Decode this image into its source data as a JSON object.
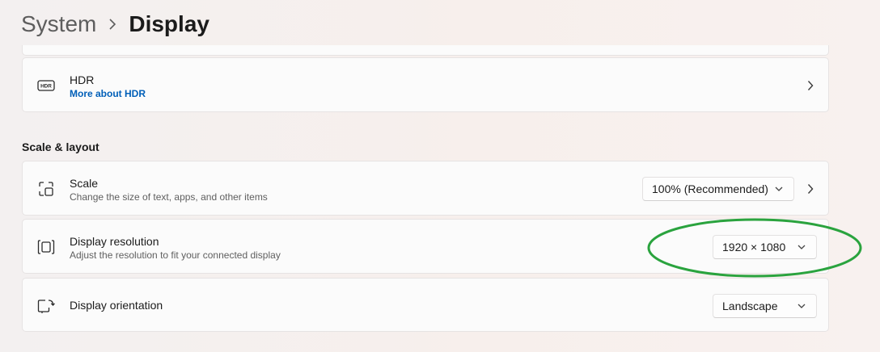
{
  "breadcrumb": {
    "parent": "System",
    "separator_icon": "chevron-right-icon",
    "current": "Display"
  },
  "hdr": {
    "icon": "hdr-icon",
    "title": "HDR",
    "link": "More about HDR"
  },
  "section": {
    "title": "Scale & layout"
  },
  "scale": {
    "icon": "scale-icon",
    "title": "Scale",
    "subtitle": "Change the size of text, apps, and other items",
    "value": "100% (Recommended)"
  },
  "resolution": {
    "icon": "display-resolution-icon",
    "title": "Display resolution",
    "subtitle": "Adjust the resolution to fit your connected display",
    "value": "1920 × 1080"
  },
  "orientation": {
    "icon": "display-orientation-icon",
    "title": "Display orientation",
    "value": "Landscape"
  },
  "colors": {
    "accent_link": "#005fb8",
    "annotation": "#2aa33e"
  }
}
